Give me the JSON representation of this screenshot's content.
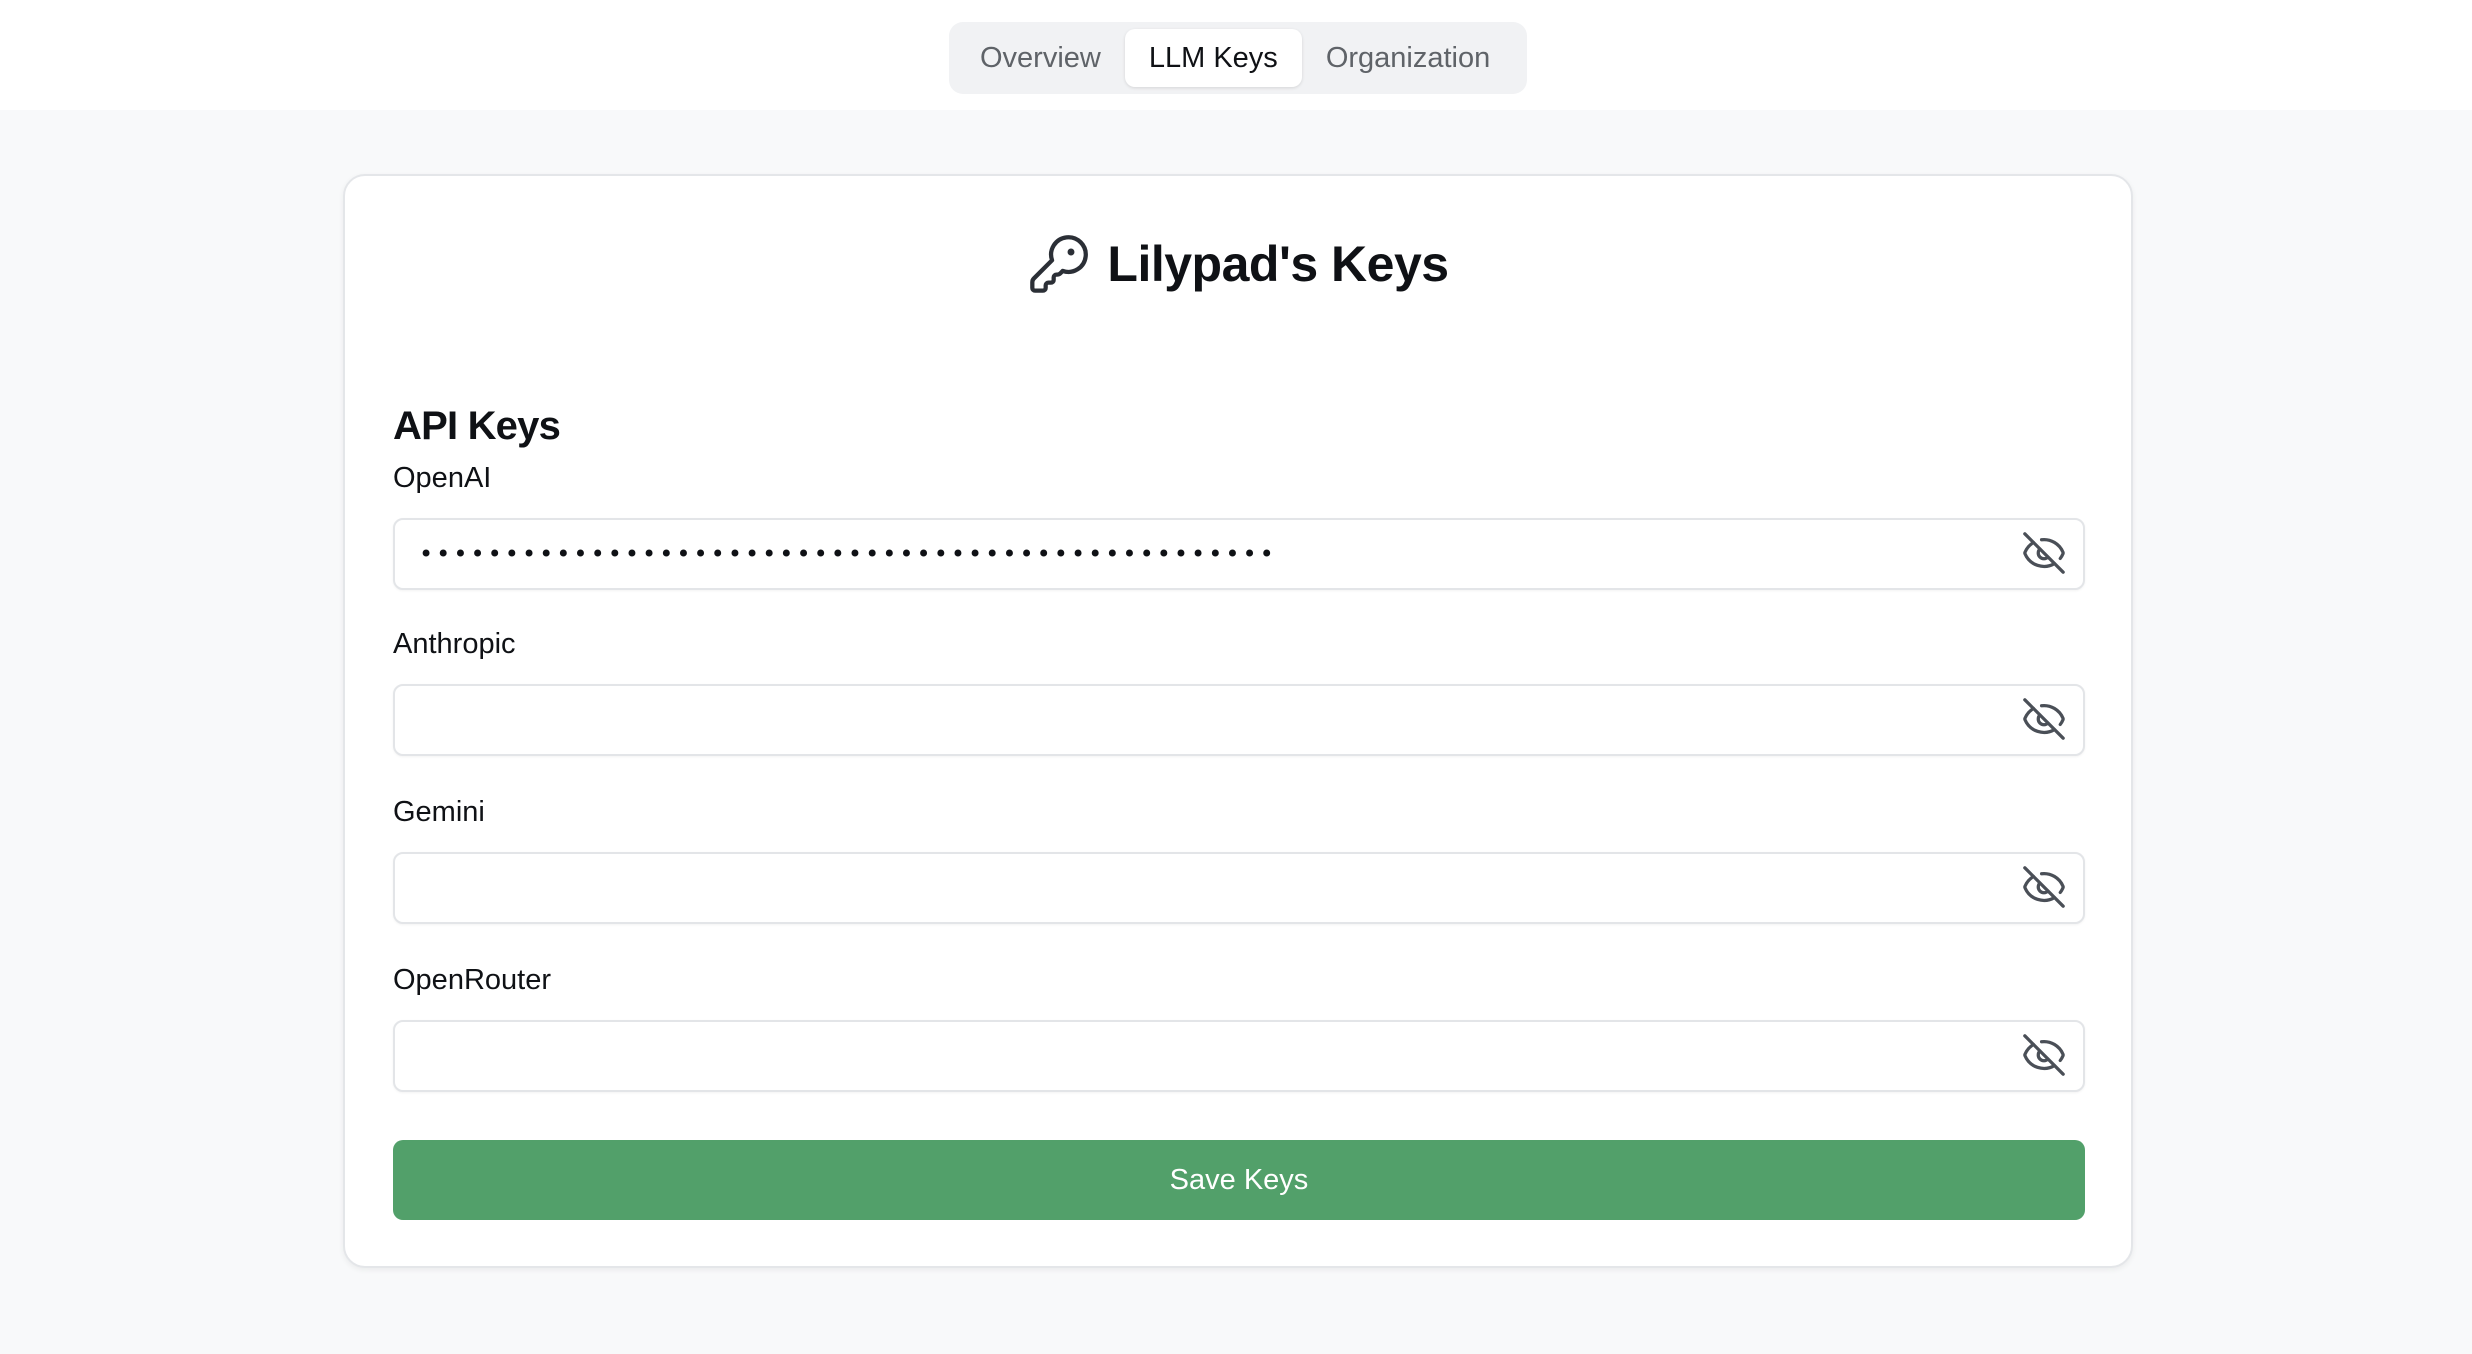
{
  "nav": {
    "tabs": [
      {
        "label": "Overview",
        "active": false
      },
      {
        "label": "LLM Keys",
        "active": true
      },
      {
        "label": "Organization",
        "active": false
      }
    ]
  },
  "card": {
    "title": "Lilypad's Keys",
    "title_icon": "key-icon",
    "section_title": "API Keys",
    "fields": [
      {
        "label": "OpenAI",
        "value": "••••••••••••••••••••••••••••••••••••••••••••••••••",
        "placeholder": "",
        "toggle_icon": "eye-off-icon"
      },
      {
        "label": "Anthropic",
        "value": "",
        "placeholder": "",
        "toggle_icon": "eye-off-icon"
      },
      {
        "label": "Gemini",
        "value": "",
        "placeholder": "",
        "toggle_icon": "eye-off-icon"
      },
      {
        "label": "OpenRouter",
        "value": "",
        "placeholder": "",
        "toggle_icon": "eye-off-icon"
      }
    ],
    "save_label": "Save Keys"
  },
  "colors": {
    "accent": "#52a06a",
    "page_background": "#f8f9fa",
    "tab_background": "#f1f2f4"
  }
}
